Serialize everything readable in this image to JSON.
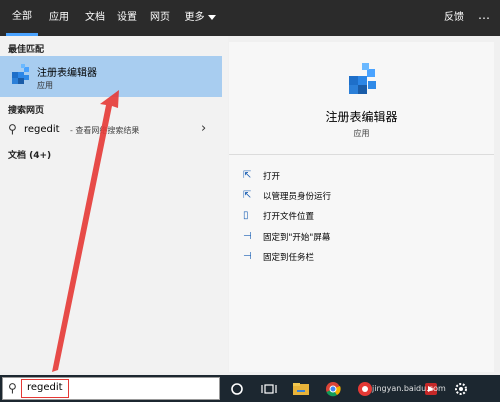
{
  "tabs": [
    {
      "label": "全部",
      "active": true
    },
    {
      "label": "应用",
      "active": false
    },
    {
      "label": "文档",
      "active": false
    },
    {
      "label": "设置",
      "active": false
    },
    {
      "label": "网页",
      "active": false
    },
    {
      "label": "更多",
      "active": false
    }
  ],
  "top_right": {
    "feedback_label": "反馈",
    "more_icon": "ellipsis-icon"
  },
  "left": {
    "best_match_heading": "最佳匹配",
    "best_match": {
      "title": "注册表编辑器",
      "subtitle": "应用",
      "icon": "registry-editor-icon"
    },
    "web_heading": "搜索网页",
    "web_result": {
      "query": "regedit",
      "suffix": " - 查看网络搜索结果"
    },
    "docs_heading": "文档 (4+)"
  },
  "right": {
    "title": "注册表编辑器",
    "subtitle": "应用",
    "actions": [
      {
        "label": "打开",
        "icon": "open-icon"
      },
      {
        "label": "以管理员身份运行",
        "icon": "run-as-admin-icon"
      },
      {
        "label": "打开文件位置",
        "icon": "file-location-icon"
      },
      {
        "label": "固定到\"开始\"屏幕",
        "icon": "pin-start-icon"
      },
      {
        "label": "固定到任务栏",
        "icon": "pin-taskbar-icon"
      }
    ]
  },
  "taskbar": {
    "search_value": "regedit",
    "items": [
      "cortana-icon",
      "task-view-icon",
      "file-explorer-icon",
      "chrome-icon",
      "app-icon",
      "app-icon-2",
      "settings-icon"
    ]
  },
  "watermark": "jingyan.baidu.com",
  "colors": {
    "accent": "#4aa3ff",
    "selection": "#a8cdf0",
    "arrow": "#e53935",
    "topbar": "#2b2b2b",
    "taskbar": "#1c2730"
  }
}
